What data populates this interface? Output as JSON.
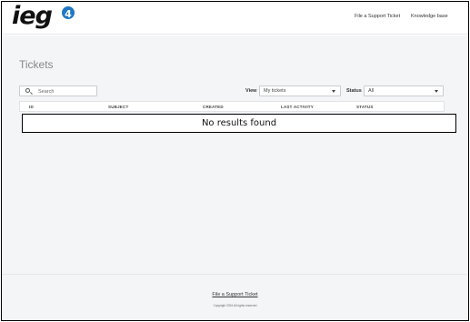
{
  "header": {
    "logo_text": "ieg",
    "logo_badge": "4",
    "nav": {
      "file_ticket": "File a Support Ticket",
      "knowledge_base": "Knowledge base"
    }
  },
  "main": {
    "title": "Tickets",
    "search": {
      "placeholder": "Search",
      "value": ""
    },
    "view": {
      "label": "View",
      "selected": "My tickets"
    },
    "status": {
      "label": "Status",
      "selected": "All"
    },
    "table": {
      "columns": [
        "ID",
        "SUBJECT",
        "CREATED",
        "LAST ACTIVITY",
        "STATUS"
      ],
      "rows": [],
      "empty_message": "No results found"
    }
  },
  "footer": {
    "link": "File a Support Ticket",
    "copyright": "Copyright 2024 All rights reserved"
  },
  "colors": {
    "brand_blue": "#1f78c4",
    "page_bg": "#f4f5f7"
  }
}
